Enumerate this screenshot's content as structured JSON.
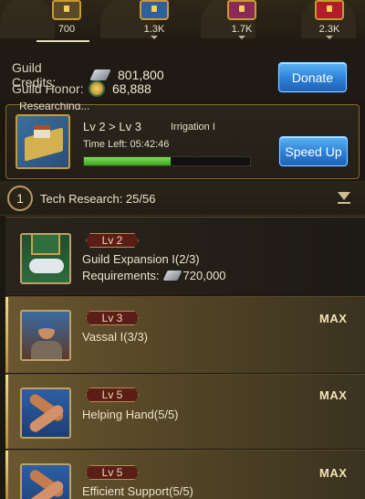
{
  "chests": [
    {
      "count": "700",
      "color": "#5a4a2a",
      "icon": "treasure-chest-icon"
    },
    {
      "count": "1.3K",
      "color": "#2f5f9f",
      "icon": "treasure-chest-icon"
    },
    {
      "count": "1.7K",
      "color": "#8a2a5a",
      "icon": "treasure-chest-icon"
    },
    {
      "count": "2.3K",
      "color": "#b01e2a",
      "icon": "treasure-chest-icon"
    }
  ],
  "guild": {
    "credits_label": "Guild Credits:",
    "credits_value": "801,800",
    "honor_label": "Guild Honor:",
    "honor_value": "68,888",
    "donate_label": "Donate"
  },
  "researching": {
    "title": "Researching...",
    "level": "Lv 2 > Lv 3",
    "name": "Irrigation I",
    "time_left": "Time Left: 05:42:46",
    "progress": 0.52,
    "speed_up_label": "Speed Up"
  },
  "tech_header": {
    "number": "1",
    "title": "Tech Research: 25/56"
  },
  "techs": [
    {
      "level": "Lv 2",
      "name": "Guild Expansion I(2/3)",
      "requirements_label": "Requirements:",
      "requirements_value": "720,000",
      "max": ""
    },
    {
      "level": "Lv 3",
      "name": "Vassal I(3/3)",
      "max": "MAX"
    },
    {
      "level": "Lv 5",
      "name": "Helping Hand(5/5)",
      "max": "MAX"
    },
    {
      "level": "Lv 5",
      "name": "Efficient Support(5/5)",
      "max": "MAX"
    }
  ],
  "colors": {
    "accent_blue": "#2d7fd6",
    "progress_green": "#3da423",
    "gold": "#c9a24a"
  }
}
